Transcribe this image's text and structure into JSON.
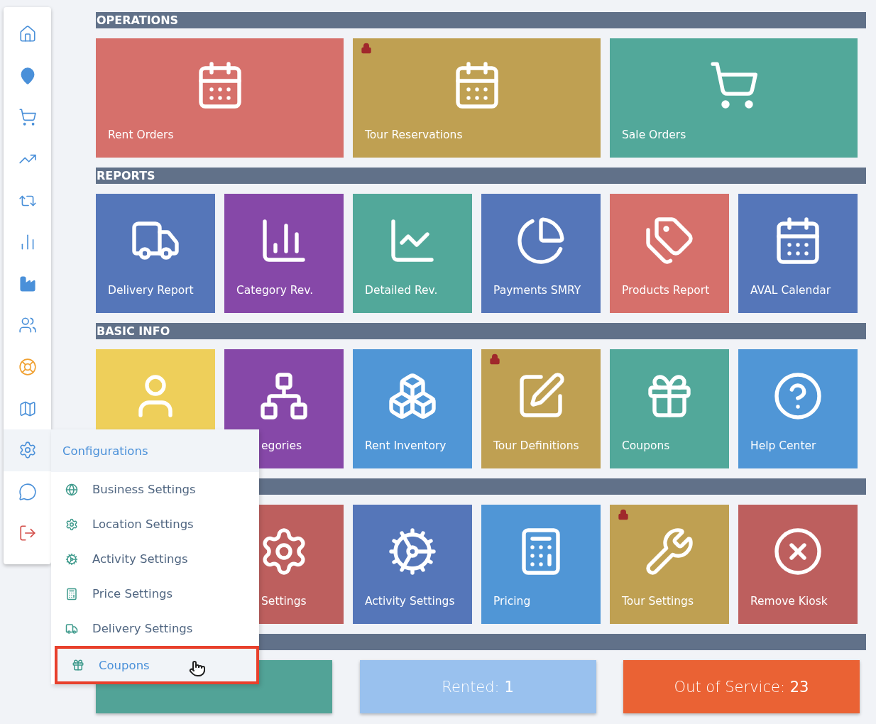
{
  "sidebar": {
    "items": [
      {
        "selected": false
      },
      {
        "selected": false
      },
      {
        "selected": false
      },
      {
        "selected": false
      },
      {
        "selected": false
      },
      {
        "selected": false
      },
      {
        "selected": false
      },
      {
        "selected": false
      },
      {
        "selected": false
      },
      {
        "selected": false
      },
      {
        "selected": true
      },
      {
        "selected": false
      },
      {
        "selected": false
      }
    ]
  },
  "flyout": {
    "title": "Configurations",
    "items": [
      {
        "label": "Business Settings",
        "selected": false
      },
      {
        "label": "Location Settings",
        "selected": false
      },
      {
        "label": "Activity Settings",
        "selected": false
      },
      {
        "label": "Price Settings",
        "selected": false
      },
      {
        "label": "Delivery Settings",
        "selected": false
      },
      {
        "label": "Coupons",
        "selected": true
      }
    ]
  },
  "sections": [
    {
      "kind": "tiles",
      "title": "OPERATIONS",
      "tiles": [
        {
          "label": "Rent Orders",
          "color": "#d6706b",
          "locked": false
        },
        {
          "label": "Tour Reservations",
          "color": "#bfa052",
          "locked": true
        },
        {
          "label": "Sale Orders",
          "color": "#52a89a",
          "locked": false
        }
      ]
    },
    {
      "kind": "tiles",
      "title": "REPORTS",
      "tiles": [
        {
          "label": "Delivery Report",
          "color": "#5576b9",
          "locked": false
        },
        {
          "label": "Category Rev.",
          "color": "#8648a8",
          "locked": false
        },
        {
          "label": "Detailed Rev.",
          "color": "#52a89a",
          "locked": false
        },
        {
          "label": "Payments SMRY",
          "color": "#5576b9",
          "locked": false
        },
        {
          "label": "Products Report",
          "color": "#d6706b",
          "locked": false
        },
        {
          "label": "AVAL Calendar",
          "color": "#5576b9",
          "locked": false
        }
      ]
    },
    {
      "kind": "tiles",
      "title": "BASIC INFO",
      "tiles": [
        {
          "color": "#eecf5a",
          "locked": false
        },
        {
          "label": "egories",
          "label_clipped": true,
          "color": "#8648a8",
          "locked": false
        },
        {
          "label": "Rent Inventory",
          "color": "#5096d6",
          "locked": false
        },
        {
          "label": "Tour Definitions",
          "color": "#bfa052",
          "locked": true
        },
        {
          "label": "Coupons",
          "color": "#52a89a",
          "locked": false
        },
        {
          "label": "Help Center",
          "color": "#5096d6",
          "locked": false
        }
      ]
    },
    {
      "kind": "tiles",
      "tiles": [
        {
          "label": "Settings",
          "label_clipped": true,
          "color": "#bd5f5e",
          "locked": false
        },
        {
          "label": "Activity Settings",
          "color": "#5576b9",
          "locked": false
        },
        {
          "label": "Pricing",
          "color": "#5096d6",
          "locked": false
        },
        {
          "label": "Tour Settings",
          "color": "#bfa052",
          "locked": true
        },
        {
          "label": "Remove Kiosk",
          "color": "#bd5f5e",
          "locked": false
        }
      ]
    },
    {
      "kind": "stats",
      "stats": [
        {
          "color": "#52a397"
        },
        {
          "text": "Rented: **1**",
          "color": "#99c1ee"
        },
        {
          "text": "Out of Service: **23**",
          "color": "#ea6234"
        }
      ]
    }
  ]
}
